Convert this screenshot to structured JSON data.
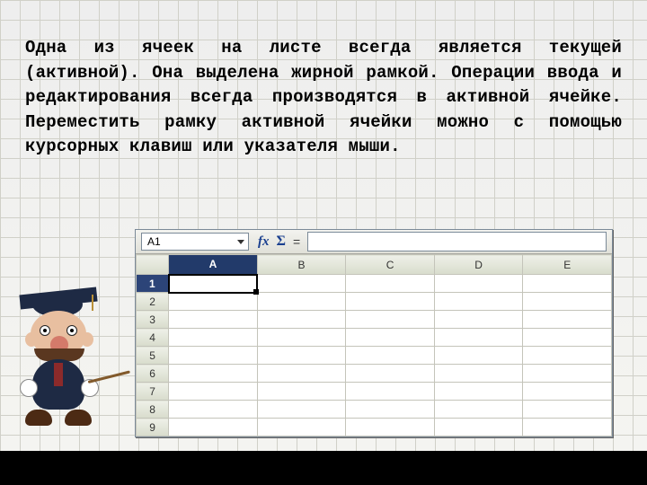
{
  "text": {
    "paragraph": "Одна из ячеек на листе всегда является текущей (активной). Она выделена жирной рамкой. Операции ввода и редактирования всегда производятся в активной ячейке. Переместить рамку активной ячейки можно с помощью курсорных клавиш или указателя мыши."
  },
  "formula_bar": {
    "name_box": "A1",
    "fx": "fx",
    "sigma": "Σ",
    "equals": "="
  },
  "sheet": {
    "columns": [
      "A",
      "B",
      "C",
      "D",
      "E"
    ],
    "rows": [
      "1",
      "2",
      "3",
      "4",
      "5",
      "6",
      "7",
      "8",
      "9"
    ],
    "active": {
      "col": "A",
      "row": "1"
    }
  }
}
